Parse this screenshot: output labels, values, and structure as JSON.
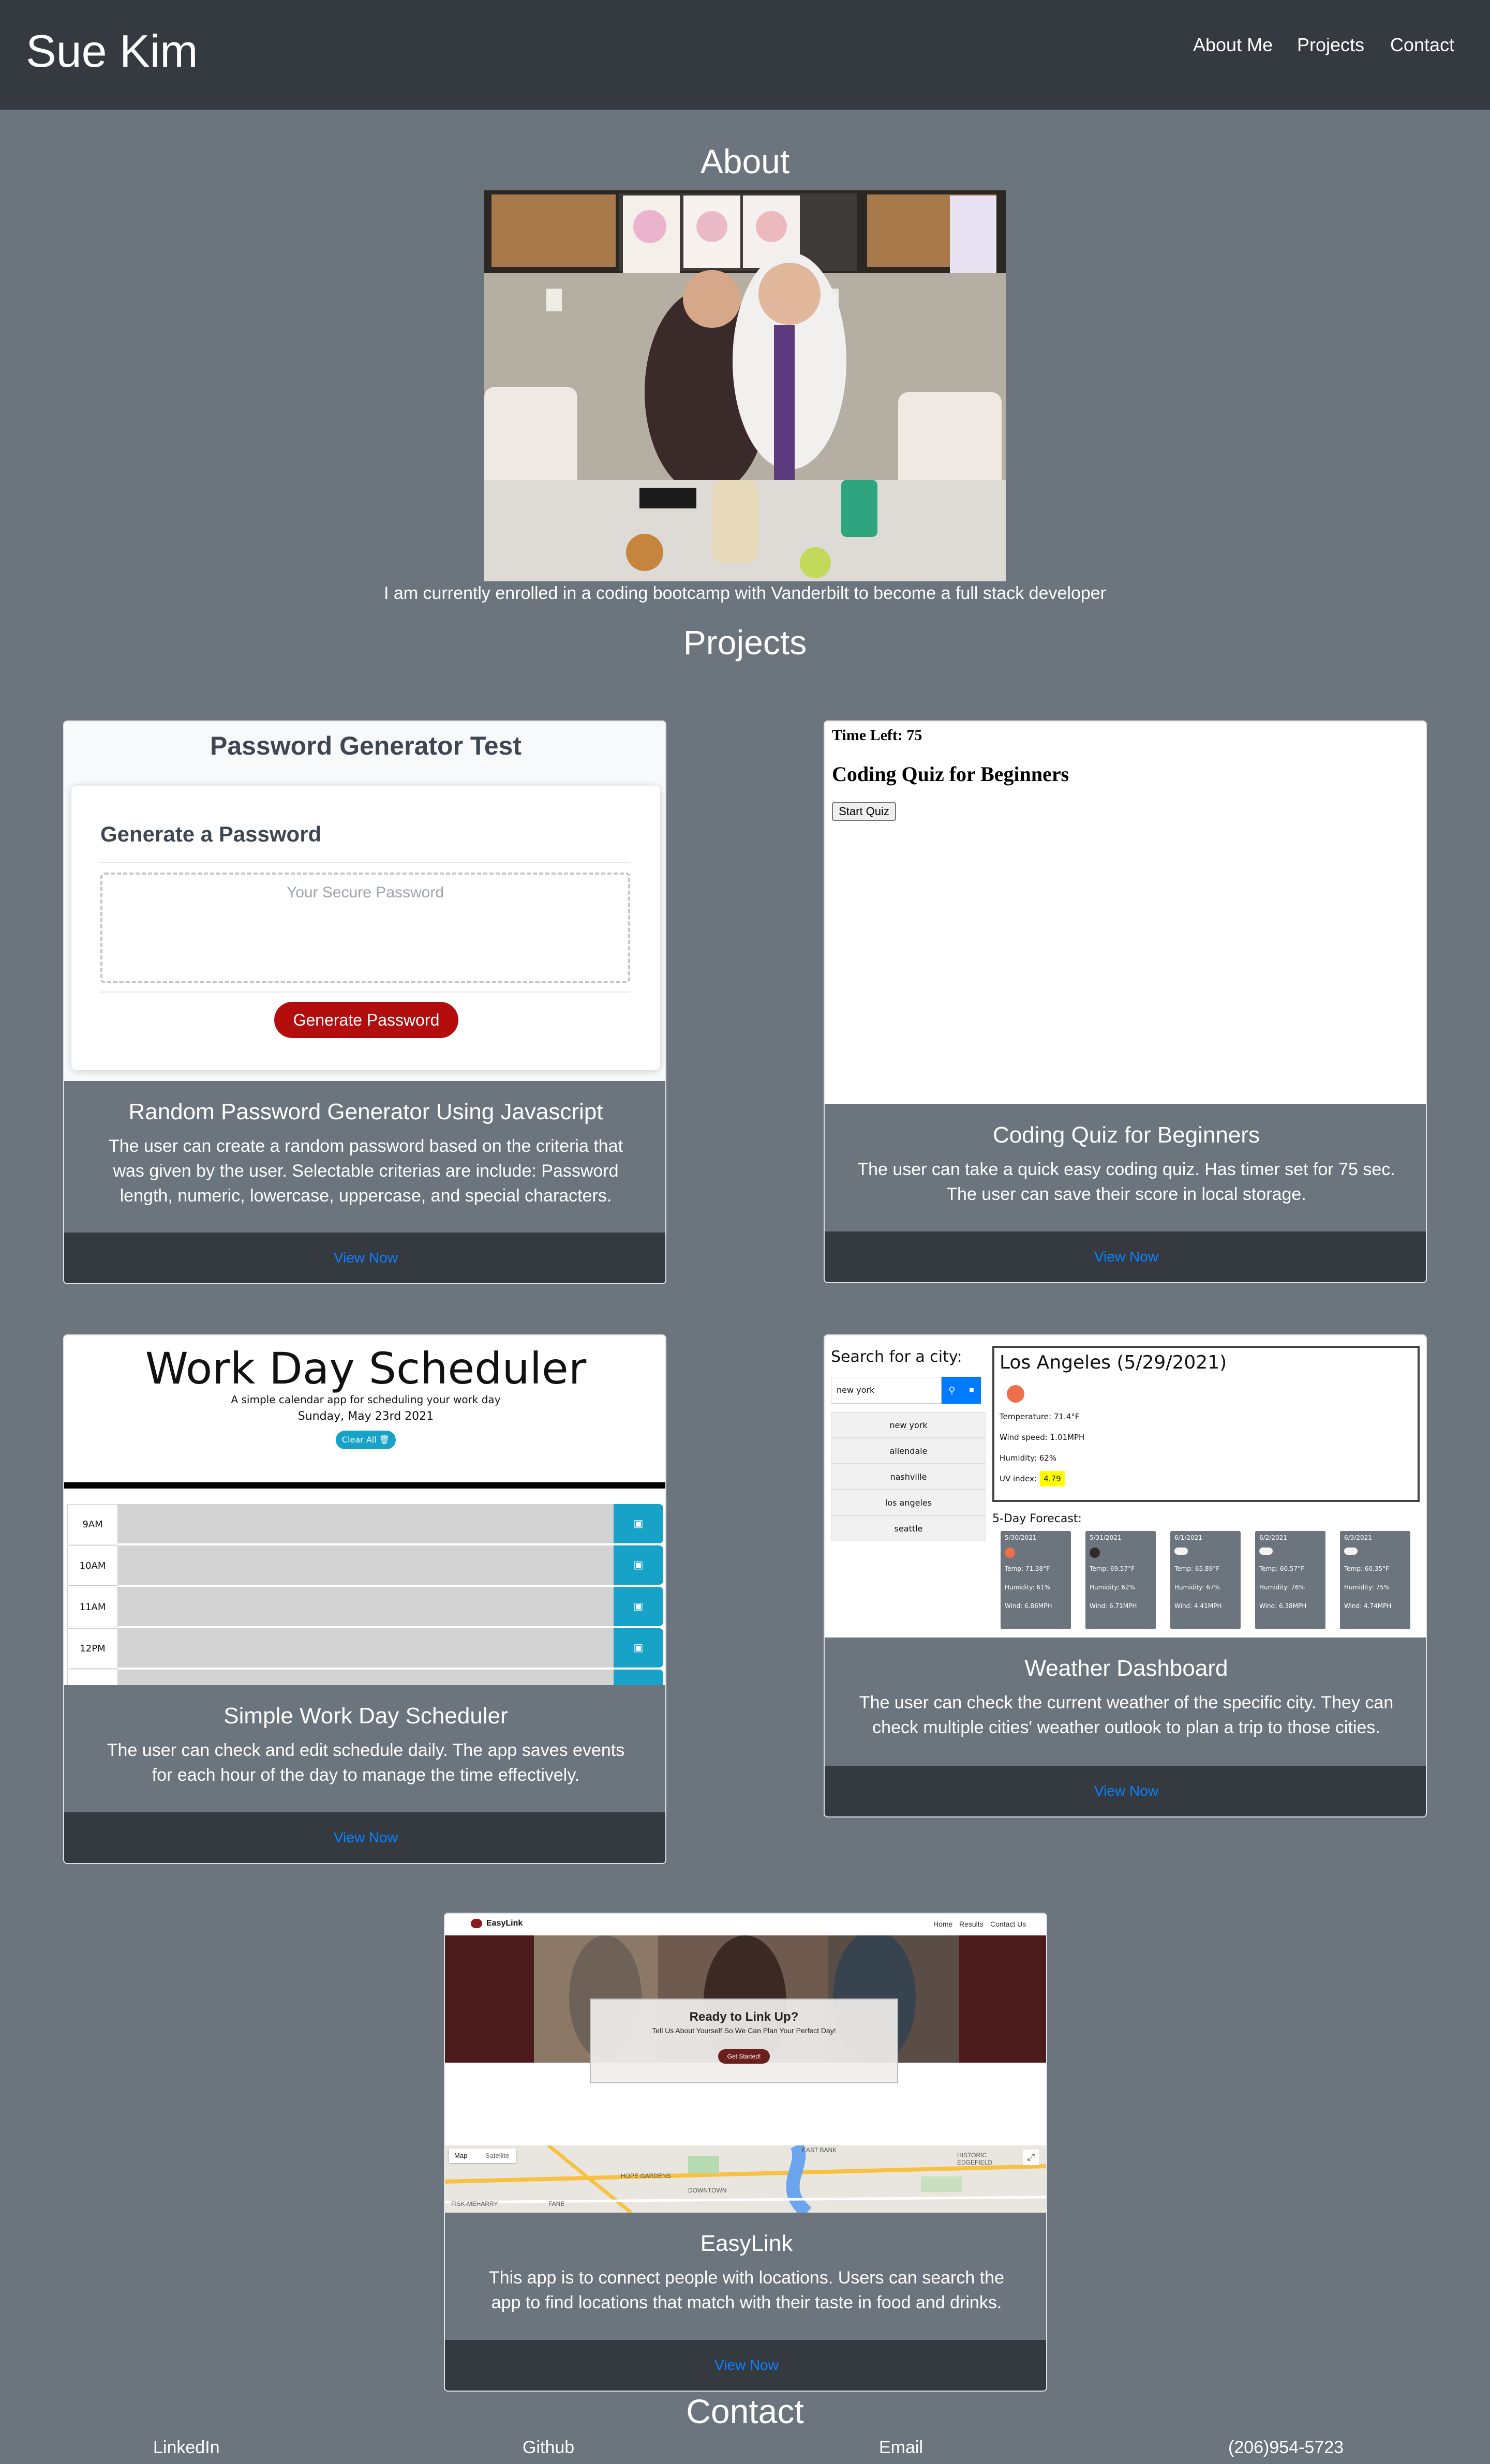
{
  "header": {
    "brand": "Sue Kim",
    "nav": [
      "About Me",
      "Projects",
      "Contact"
    ]
  },
  "about": {
    "heading": "About",
    "text": "I am currently enrolled in a coding bootcamp with Vanderbilt to become a full stack developer"
  },
  "projects": {
    "heading": "Projects",
    "cards": [
      {
        "title": "Random Password Generator Using Javascript",
        "text": "The user can create a random password based on the criteria that was given by the user. Selectable criterias are include: Password length, numeric, lowercase, uppercase, and special characters.",
        "link": "View Now",
        "preview": {
          "title": "Password Generator Test",
          "subtitle": "Generate a Password",
          "placeholder": "Your Secure Password",
          "button": "Generate Password"
        }
      },
      {
        "title": "Coding Quiz for Beginners",
        "text": "The user can take a quick easy coding quiz. Has timer set for 75 sec. The user can save their score in local storage.",
        "link": "View Now",
        "preview": {
          "timer": "Time Left: 75",
          "title": "Coding Quiz for Beginners",
          "button": "Start Quiz"
        }
      },
      {
        "title": "Simple Work Day Scheduler",
        "text": "The user can check and edit schedule daily. The app saves events for each hour of the day to manage the time effectively.",
        "link": "View Now",
        "preview": {
          "title": "Work Day Scheduler",
          "subtitle": "A simple calendar app for scheduling your work day",
          "date": "Sunday, May 23rd 2021",
          "clear": "Clear All 🗑",
          "hours": [
            "9AM",
            "10AM",
            "11AM",
            "12PM"
          ]
        }
      },
      {
        "title": "Weather Dashboard",
        "text": "The user can check the current weather of the specific city. They can check multiple cities' weather outlook to plan a trip to those cities.",
        "link": "View Now",
        "preview": {
          "search_label": "Search for a city:",
          "search_value": "new york",
          "cities": [
            "new york",
            "allendale",
            "nashville",
            "los angeles",
            "seattle"
          ],
          "current_city": "Los Angeles (5/29/2021)",
          "temperature": "Temperature: 71.4°F",
          "wind": "Wind speed: 1.01MPH",
          "humidity": "Humidity: 62%",
          "uv_label": "UV index:",
          "uv_value": "4.79",
          "forecast_label": "5-Day Forecast:",
          "forecast": [
            {
              "date": "5/30/2021",
              "temp": "Temp: 71.38°F",
              "humidity": "Humidity: 61%",
              "wind": "Wind: 6.86MPH"
            },
            {
              "date": "5/31/2021",
              "temp": "Temp: 69.57°F",
              "humidity": "Humidity: 62%",
              "wind": "Wind: 6.71MPH"
            },
            {
              "date": "6/1/2021",
              "temp": "Temp: 65.89°F",
              "humidity": "Humidity: 67%",
              "wind": "Wind: 4.41MPH"
            },
            {
              "date": "6/2/2021",
              "temp": "Temp: 60.57°F",
              "humidity": "Humidity: 76%",
              "wind": "Wind: 6.38MPH"
            },
            {
              "date": "6/3/2021",
              "temp": "Temp: 60.35°F",
              "humidity": "Humidity: 75%",
              "wind": "Wind: 4.74MPH"
            }
          ]
        }
      },
      {
        "title": "EasyLink",
        "text": "This app is to connect people with locations. Users can search the app to find locations that match with their taste in food and drinks.",
        "link": "View Now",
        "preview": {
          "logo": "EasyLink",
          "nav": [
            "Home",
            "Results",
            "Contact Us"
          ],
          "hero_title": "Ready to Link Up?",
          "hero_sub": "Tell Us About Yourself So We Can Plan Your Perfect Day!",
          "hero_button": "Get Started!",
          "map_tabs": [
            "Map",
            "Satellite"
          ],
          "map_labels": [
            "EAST BANK",
            "HISTORIC EDGEFIELD",
            "HOPE GARDENS",
            "DOWNTOWN",
            "FISK-MEHARRY",
            "FANE"
          ]
        }
      }
    ]
  },
  "contact": {
    "heading": "Contact",
    "links": [
      "LinkedIn",
      "Github",
      "Email",
      "(206)954-5723"
    ]
  },
  "colors": {
    "page_bg": "#6c757d",
    "dark": "#343a40",
    "link": "#0d80ff",
    "password_button": "#b40d0d",
    "scheduler_accent": "#17a2c8",
    "weather_accent": "#007bff"
  }
}
